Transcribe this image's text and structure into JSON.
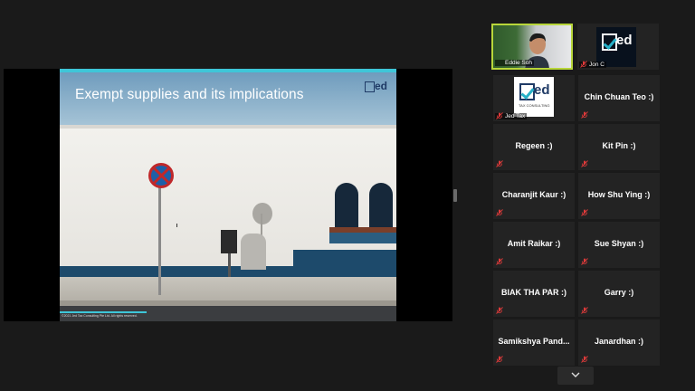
{
  "shared_screen": {
    "slide_title": "Exempt supplies and its implications",
    "logo_text": "ed",
    "footer": "©2021 Jed Tax Consulting Pte Ltd. All rights reserved."
  },
  "gallery": {
    "video_tiles": [
      {
        "name": "Eddie Soh",
        "muted": false,
        "active": true
      },
      {
        "name": "Jon C",
        "muted": true
      },
      {
        "name": "Jed Tax",
        "muted": true,
        "logo_word": "ed",
        "logo_sub": "TAX CONSULTING"
      }
    ],
    "name_tiles": [
      {
        "name": "Chin Chuan Teo :)"
      },
      {
        "name": "Regeen :)"
      },
      {
        "name": "Kit Pin :)"
      },
      {
        "name": "Charanjit Kaur :)"
      },
      {
        "name": "How Shu Ying :)"
      },
      {
        "name": "Amit Raikar :)"
      },
      {
        "name": "Sue Shyan :)"
      },
      {
        "name": "BIAK THA PAR :)"
      },
      {
        "name": "Garry :)"
      },
      {
        "name": "Samikshya  Pand..."
      },
      {
        "name": "Janardhan :)"
      }
    ]
  },
  "icons": {
    "mute": "microphone-muted-icon",
    "scroll": "chevron-down-icon"
  },
  "colors": {
    "active_speaker": "#b8d63a",
    "mute_icon": "#e03a3a",
    "accent": "#3ec6d8"
  }
}
